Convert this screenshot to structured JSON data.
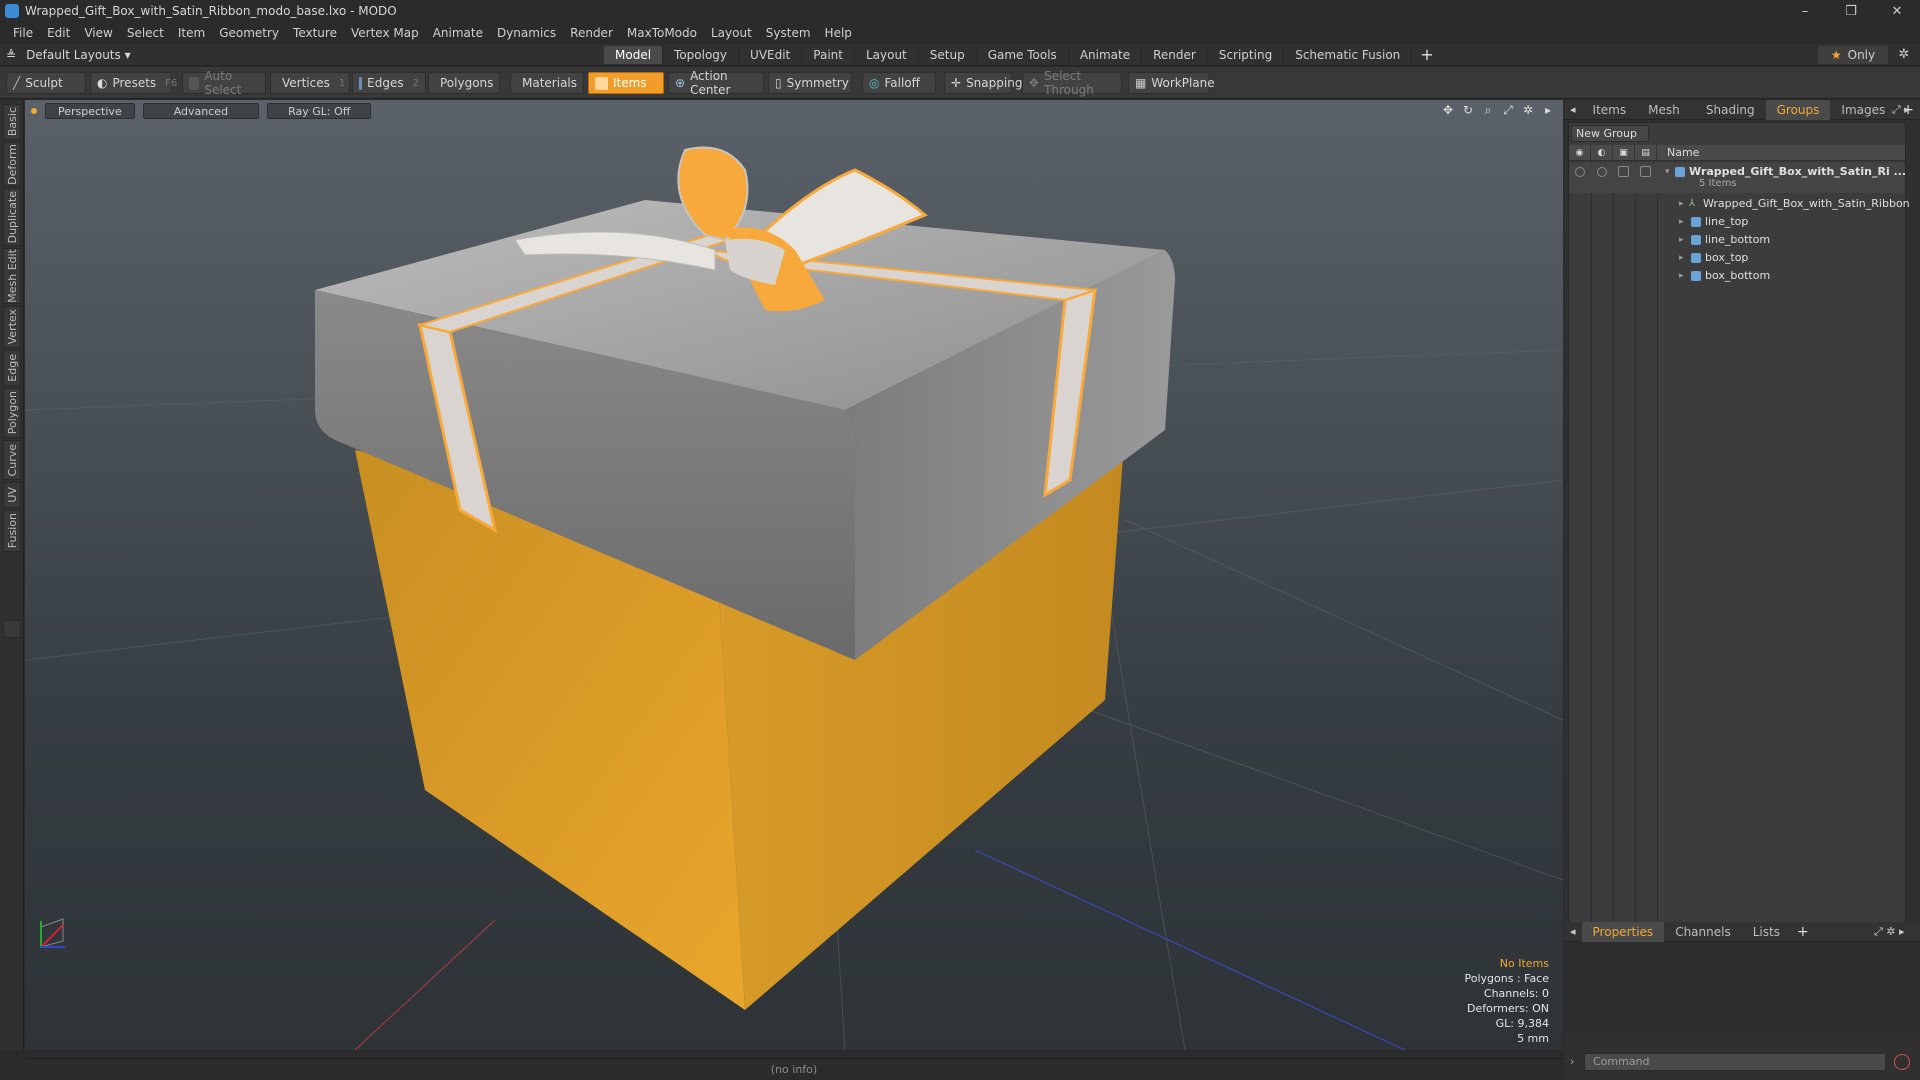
{
  "window": {
    "title": "Wrapped_Gift_Box_with_Satin_Ribbon_modo_base.lxo - MODO",
    "controls": [
      "–",
      "❐",
      "✕"
    ]
  },
  "menu": [
    "File",
    "Edit",
    "View",
    "Select",
    "Item",
    "Geometry",
    "Texture",
    "Vertex Map",
    "Animate",
    "Dynamics",
    "Render",
    "MaxToModo",
    "Layout",
    "System",
    "Help"
  ],
  "layout": {
    "selector": "Default Layouts ▾",
    "tabs": [
      "Model",
      "Topology",
      "UVEdit",
      "Paint",
      "Layout",
      "Setup",
      "Game Tools",
      "Animate",
      "Render",
      "Scripting",
      "Schematic Fusion"
    ],
    "active_tab": "Model",
    "add_tab": "+",
    "only_label": "Only"
  },
  "toolbar": {
    "sculpt": "Sculpt",
    "presets": "Presets",
    "presets_key": "F6",
    "auto_select": "Auto Select",
    "vertices": "Vertices",
    "vertices_key": "1",
    "edges": "Edges",
    "edges_key": "2",
    "polygons": "Polygons",
    "materials": "Materials",
    "items": "Items",
    "action_center": "Action Center",
    "symmetry": "Symmetry",
    "falloff": "Falloff",
    "snapping": "Snapping",
    "select_through": "Select Through",
    "workplane": "WorkPlane"
  },
  "left_tabs": [
    "Basic",
    "Deform",
    "Duplicate",
    "Mesh Edit",
    "Vertex",
    "Edge",
    "Polygon",
    "Curve",
    "UV",
    "Fusion"
  ],
  "viewport": {
    "perspective": "Perspective",
    "advanced": "Advanced",
    "raygl": "Ray GL: Off",
    "stats": {
      "no_items": "No Items",
      "polygons": "Polygons : Face",
      "channels": "Channels: 0",
      "deformers": "Deformers: ON",
      "gl": "GL: 9,384",
      "scale": "5 mm"
    }
  },
  "right_panel": {
    "tabs": [
      "Items",
      "Mesh ...",
      "Shading",
      "Groups",
      "Images"
    ],
    "active_tab": "Groups",
    "new_group": "New Group",
    "name_header": "Name",
    "root": {
      "label": "Wrapped_Gift_Box_with_Satin_Ri ...",
      "count": "5 Items"
    },
    "children": [
      "Wrapped_Gift_Box_with_Satin_Ribbon",
      "line_top",
      "line_bottom",
      "box_top",
      "box_bottom"
    ],
    "bottom_tabs": [
      "Properties",
      "Channels",
      "Lists"
    ],
    "bottom_active": "Properties",
    "command_placeholder": "Command"
  },
  "status": "(no info)",
  "colors": {
    "accent": "#f29d2a",
    "box_bottom": "#e2a12a",
    "box_lid": "#8f8f8f",
    "ribbon": "#f7a93c"
  }
}
